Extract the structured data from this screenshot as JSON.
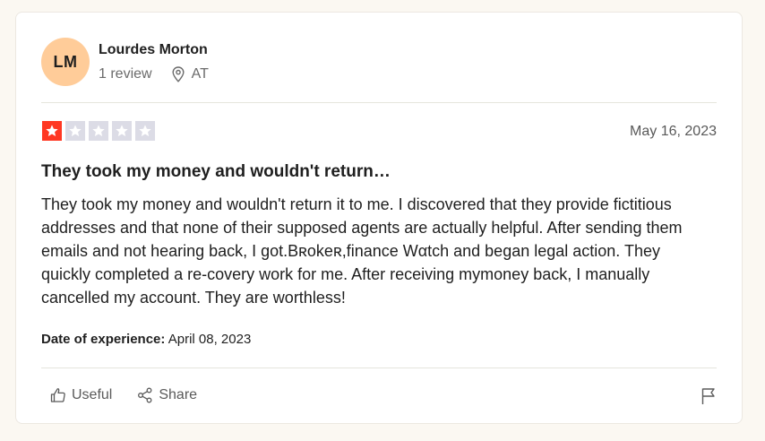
{
  "review": {
    "avatar_initials": "LM",
    "user_name": "Lourdes Morton",
    "review_count": "1 review",
    "country": "AT",
    "rating": 1,
    "rating_max": 5,
    "date": "May 16, 2023",
    "title": "They took my money and wouldn't return…",
    "body": "They took my money and wouldn't return it to me. I discovered that they provide fictitious addresses and that none of their supposed agents are actually helpful. After sending them emails and not hearing back, I got.Bʀokeʀ,ﬁnance Wαtch and began legal action. They quickly completed a re-covery work for me. After receiving mymoney back, I manually cancelled my account. They are worthless!",
    "experience_label": "Date of experience:",
    "experience_date": "April 08, 2023"
  },
  "actions": {
    "useful_label": "Useful",
    "share_label": "Share"
  },
  "icons": {
    "location": "map-pin-icon",
    "useful": "thumbs-up-icon",
    "share": "share-icon",
    "report": "flag-icon"
  },
  "colors": {
    "star_filled": "#ff3722",
    "star_empty": "#dcdce6",
    "avatar_bg": "#ffcc99",
    "page_bg": "#fbf8f2"
  }
}
